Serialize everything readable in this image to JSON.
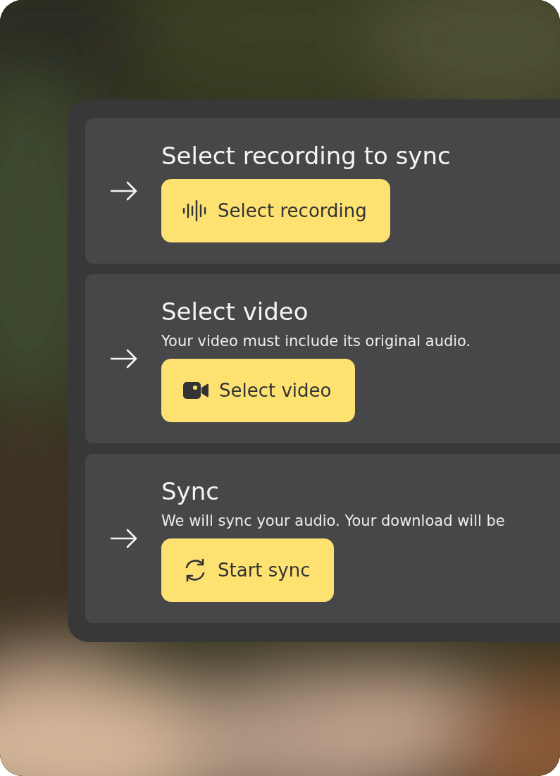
{
  "steps": [
    {
      "title": "Select recording to sync",
      "button": {
        "label": "Select recording",
        "kind": "waveform"
      }
    },
    {
      "title": "Select video",
      "description": "Your video must include its original audio.",
      "button": {
        "label": "Select video",
        "kind": "camera"
      }
    },
    {
      "title": "Sync",
      "description": "We will sync your audio. Your download will be",
      "button": {
        "label": "Start sync",
        "kind": "refresh"
      }
    }
  ]
}
